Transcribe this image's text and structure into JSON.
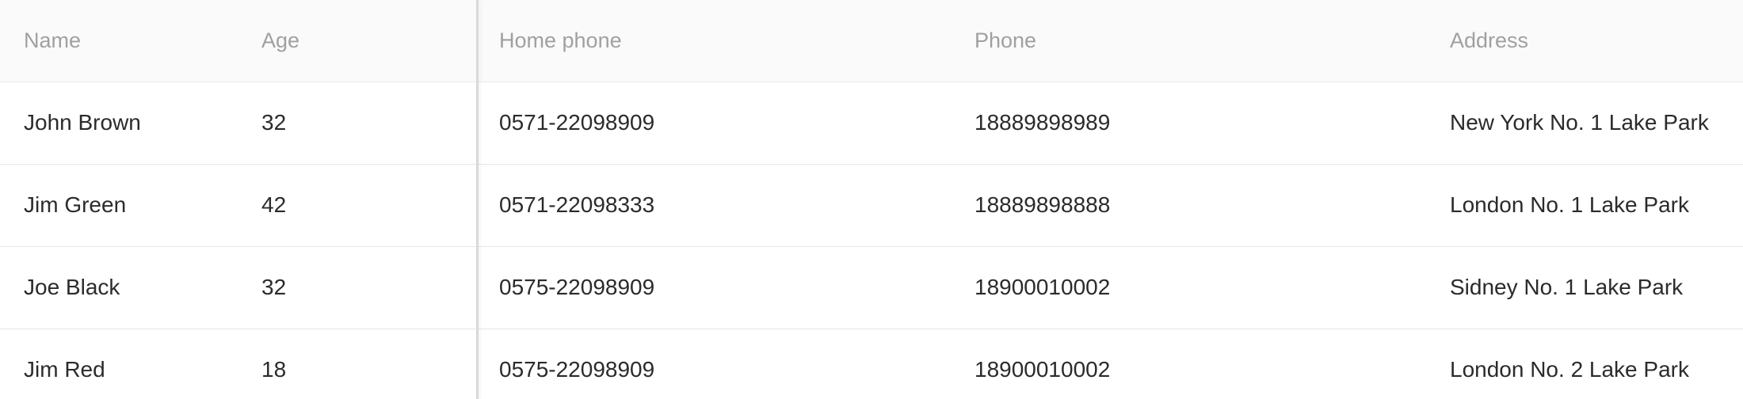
{
  "columns": [
    "Name",
    "Age",
    "Home phone",
    "Phone",
    "Address"
  ],
  "rows": [
    {
      "name": "John Brown",
      "age": "32",
      "home_phone": "0571-22098909",
      "phone": "18889898989",
      "address": "New York No. 1 Lake Park"
    },
    {
      "name": "Jim Green",
      "age": "42",
      "home_phone": "0571-22098333",
      "phone": "18889898888",
      "address": "London No. 1 Lake Park"
    },
    {
      "name": "Joe Black",
      "age": "32",
      "home_phone": "0575-22098909",
      "phone": "18900010002",
      "address": "Sidney No. 1 Lake Park"
    },
    {
      "name": "Jim Red",
      "age": "18",
      "home_phone": "0575-22098909",
      "phone": "18900010002",
      "address": "London No. 2 Lake Park"
    }
  ]
}
